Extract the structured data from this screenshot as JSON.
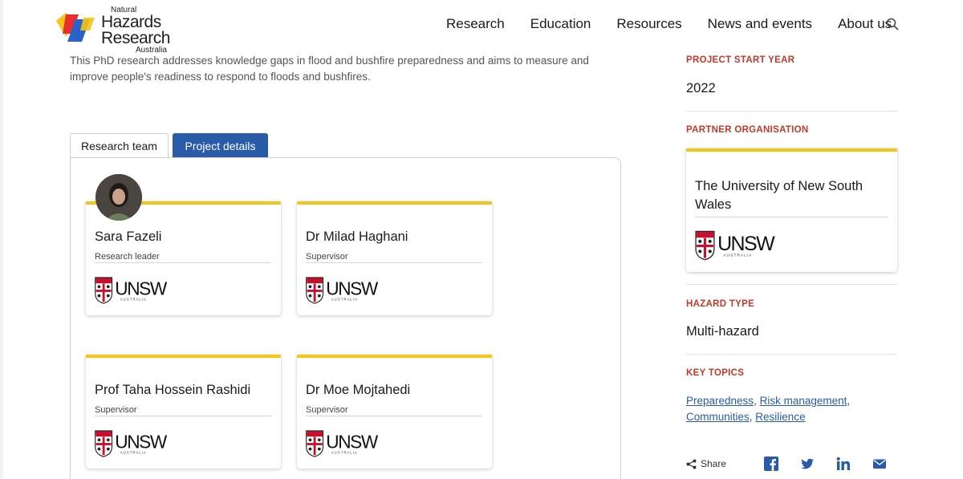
{
  "logo": {
    "natural": "Natural",
    "line1": "Hazards",
    "line2": "Research",
    "australia": "Australia"
  },
  "nav": {
    "items": [
      {
        "label": "Research"
      },
      {
        "label": "Education"
      },
      {
        "label": "Resources"
      },
      {
        "label": "News and events"
      },
      {
        "label": "About us"
      }
    ]
  },
  "intro": {
    "text": "This PhD research addresses knowledge gaps in flood and bushfire preparedness and aims to measure and improve people's readiness to respond to floods and bushfires."
  },
  "tabs": {
    "team": "Research team",
    "details": "Project details"
  },
  "team": [
    {
      "name": "Sara Fazeli",
      "role": "Research leader",
      "org_logo": "UNSW"
    },
    {
      "name": "Dr Milad Haghani",
      "role": "Supervisor",
      "org_logo": "UNSW"
    },
    {
      "name": "Prof Taha Hossein Rashidi",
      "role": "Supervisor",
      "org_logo": "UNSW"
    },
    {
      "name": "Dr Moe Mojtahedi",
      "role": "Supervisor",
      "org_logo": "UNSW"
    }
  ],
  "sidebar": {
    "start_year_label": "PROJECT START YEAR",
    "start_year": "2022",
    "partner_label": "PARTNER ORGANISATION",
    "partner_name": "The University of New South Wales",
    "partner_logo": "UNSW",
    "hazard_label": "HAZARD TYPE",
    "hazard_value": "Multi-hazard",
    "topics_label": "KEY TOPICS",
    "topics": [
      "Preparedness",
      "Risk management",
      "Communities",
      "Resilience"
    ],
    "topic_sep": ", ",
    "share_label": "Share"
  },
  "unsw_logo": {
    "text": "UNSW",
    "sub": "A U S T R A L I A"
  },
  "icons": {
    "search": "search-icon",
    "share": "share-icon",
    "facebook": "facebook-icon",
    "twitter": "twitter-icon",
    "linkedin": "linkedin-icon",
    "email": "email-icon"
  },
  "colors": {
    "accent_blue": "#2a5ba8",
    "accent_red": "#c0392b",
    "accent_yellow": "#f5c518"
  }
}
